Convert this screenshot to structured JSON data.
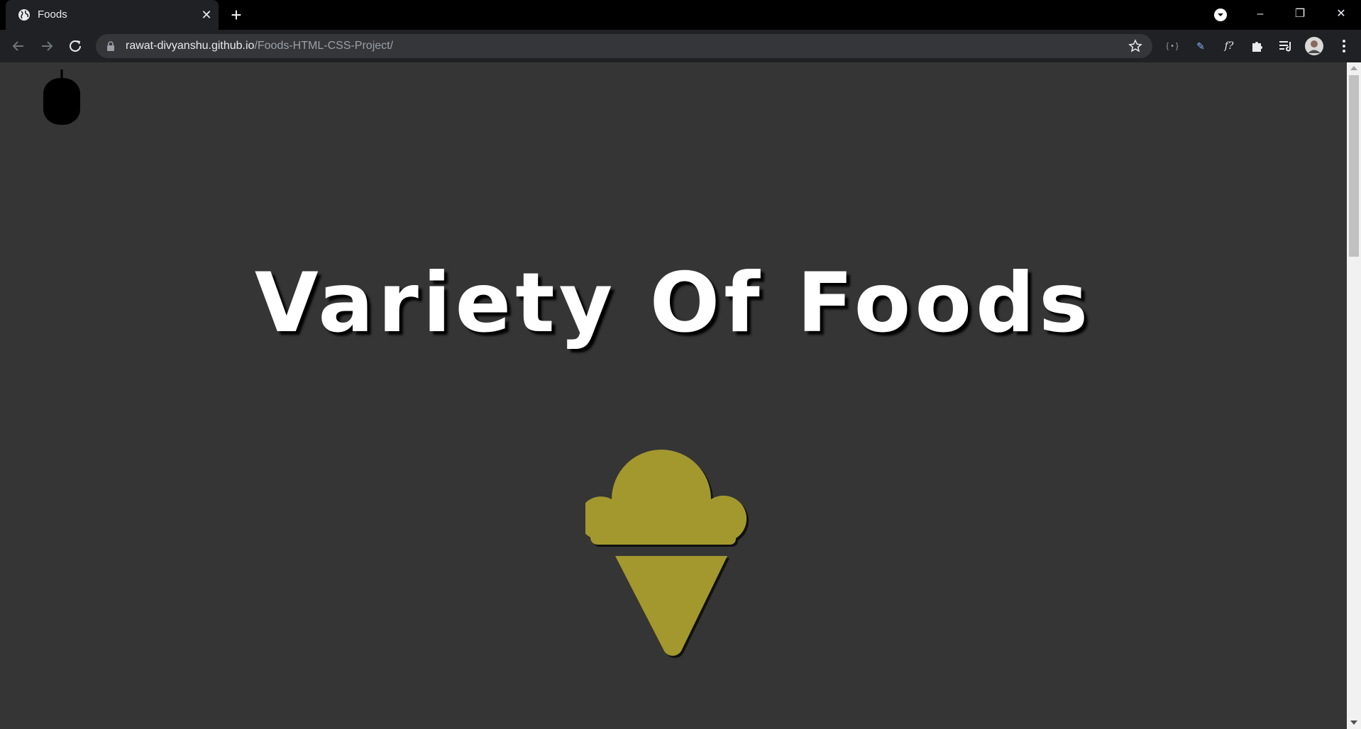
{
  "browser": {
    "tab": {
      "title": "Foods",
      "close_glyph": "✕"
    },
    "new_tab_glyph": "+",
    "window_controls": {
      "minimize_glyph": "–",
      "restore_glyph": "❐",
      "close_glyph": "✕"
    },
    "url": {
      "host": "rawat-divyanshu.github.io",
      "path": "/Foods-HTML-CSS-Project/"
    },
    "extensions": [
      {
        "name": "extension-icon-1",
        "glyph": "{ • }"
      },
      {
        "name": "extension-icon-2",
        "glyph": "✎"
      },
      {
        "name": "extension-icon-3",
        "glyph": "f?"
      }
    ]
  },
  "page": {
    "hero_title": "Variety Of Foods",
    "colors": {
      "background": "#353535",
      "icecream": "#a3982e",
      "title": "#ffffff"
    }
  }
}
